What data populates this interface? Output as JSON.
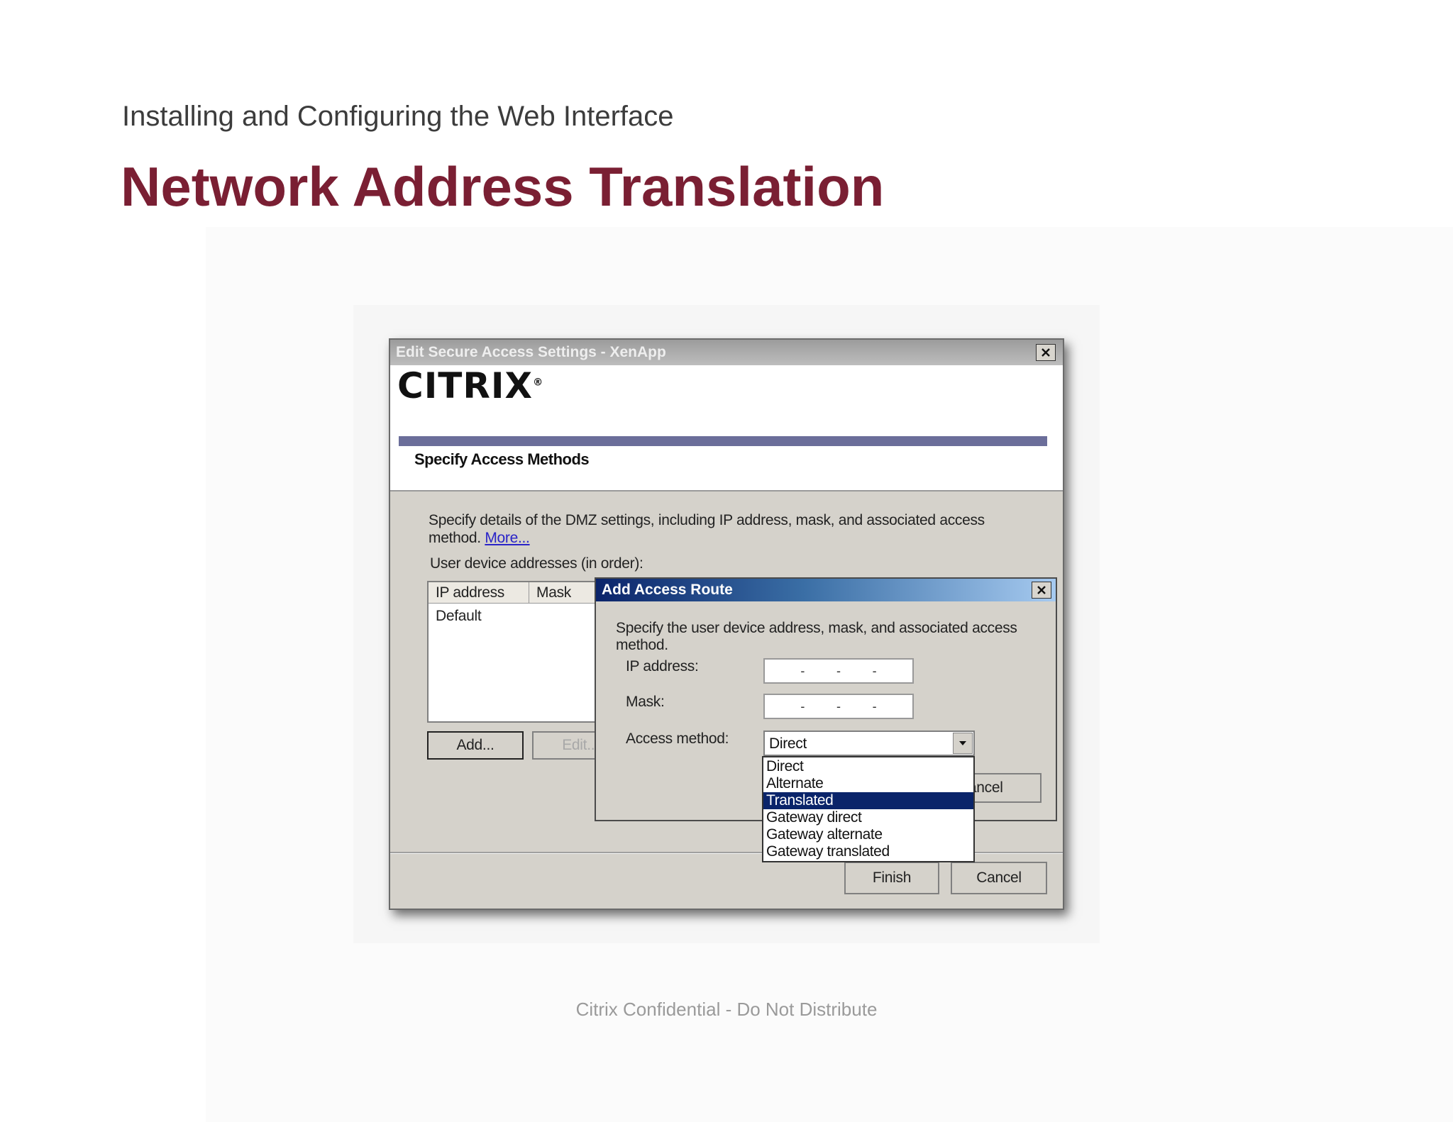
{
  "slide": {
    "subtitle": "Installing and Configuring the Web Interface",
    "title": "Network Address Translation",
    "footer": "Citrix Confidential - Do Not Distribute"
  },
  "main_dialog": {
    "title": "Edit Secure Access Settings - XenApp",
    "logo_text": "CITRIX",
    "section_title": "Specify Access Methods",
    "description": "Specify details of the DMZ settings, including IP address, mask, and associated access method.",
    "more_link": "More...",
    "list_label": "User device addresses (in order):",
    "columns": [
      "IP address",
      "Mask"
    ],
    "rows": [
      {
        "ip": "Default"
      }
    ],
    "add_button": "Add...",
    "edit_button": "Edit...",
    "finish_button": "Finish",
    "cancel_button": "Cancel"
  },
  "sub_dialog": {
    "title": "Add Access Route",
    "description": "Specify the user device address, mask, and associated access method.",
    "ip_label": "IP address:",
    "mask_label": "Mask:",
    "method_label": "Access method:",
    "method_value": "Direct",
    "cancel_button": "Cancel",
    "options": [
      "Direct",
      "Alternate",
      "Translated",
      "Gateway direct",
      "Gateway alternate",
      "Gateway translated"
    ],
    "highlighted_option": "Translated"
  },
  "colors": {
    "title_color": "#7a1f33",
    "selection": "#0a246a",
    "banner_band": "#6b6e9a"
  }
}
